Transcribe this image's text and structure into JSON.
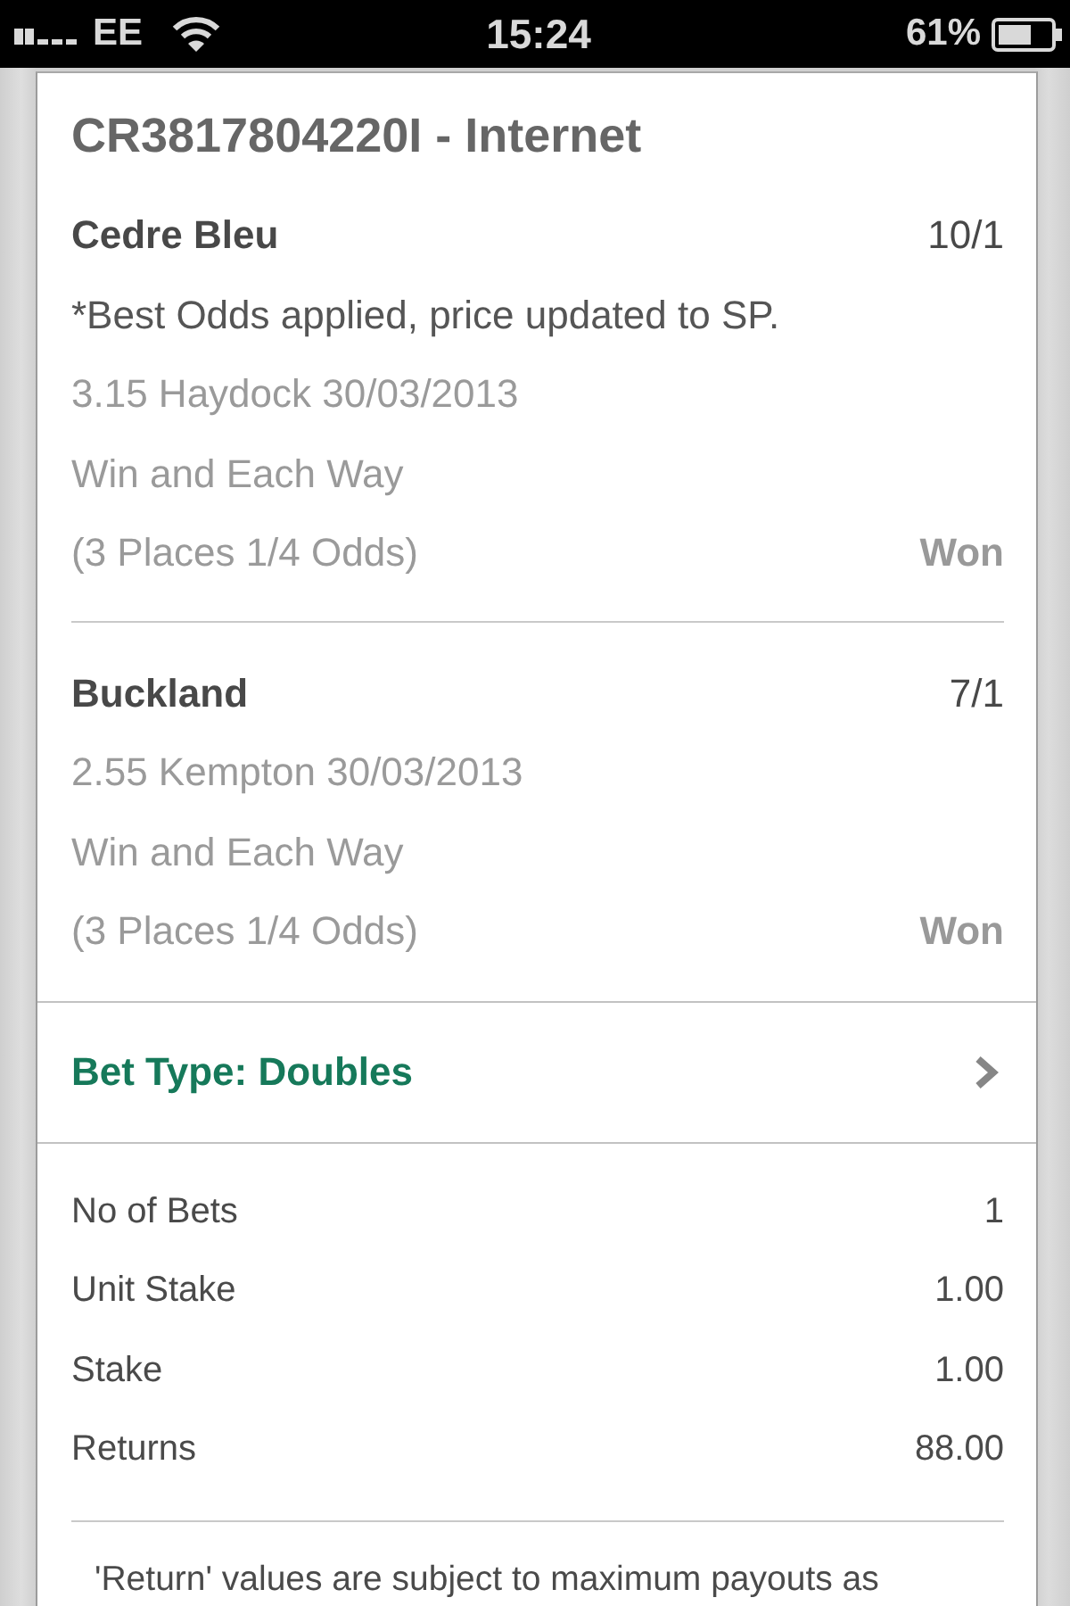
{
  "status_bar": {
    "carrier": "EE",
    "time": "15:24",
    "battery": "61%"
  },
  "bet": {
    "title": "CR3817804220I - Internet",
    "selections": [
      {
        "name": "Cedre Bleu",
        "odds": "10/1",
        "note": "*Best Odds applied, price updated to SP.",
        "event": "3.15 Haydock 30/03/2013",
        "market": "Win and Each Way",
        "terms": "(3 Places 1/4 Odds)",
        "result": "Won"
      },
      {
        "name": "Buckland",
        "odds": "7/1",
        "event": "2.55 Kempton 30/03/2013",
        "market": "Win and Each Way",
        "terms": "(3 Places 1/4 Odds)",
        "result": "Won"
      }
    ],
    "bet_type": "Bet Type: Doubles",
    "summary": [
      {
        "label": "No of Bets",
        "value": "1"
      },
      {
        "label": "Unit Stake",
        "value": "1.00"
      },
      {
        "label": "Stake",
        "value": "1.00"
      },
      {
        "label": "Returns",
        "value": "88.00"
      }
    ],
    "footnote": "'Return' values are subject to maximum payouts as"
  }
}
